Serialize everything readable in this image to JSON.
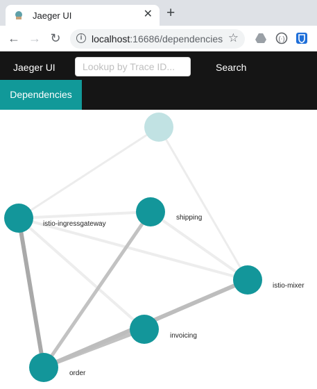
{
  "browser": {
    "tab_title": "Jaeger UI",
    "url_host": "localhost",
    "url_rest": ":16686/dependencies"
  },
  "app": {
    "brand": "Jaeger UI",
    "lookup_placeholder": "Lookup by Trace ID...",
    "search_label": "Search",
    "dependencies_label": "Dependencies"
  },
  "colors": {
    "accent": "#119999",
    "navbar": "#151515"
  },
  "graph": {
    "nodes": [
      {
        "id": "root",
        "label": ""
      },
      {
        "id": "gw",
        "label": "istio-ingressgateway"
      },
      {
        "id": "shipping",
        "label": "shipping"
      },
      {
        "id": "mixer",
        "label": "istio-mixer"
      },
      {
        "id": "invoicing",
        "label": "invoicing"
      },
      {
        "id": "order",
        "label": "order"
      }
    ]
  }
}
